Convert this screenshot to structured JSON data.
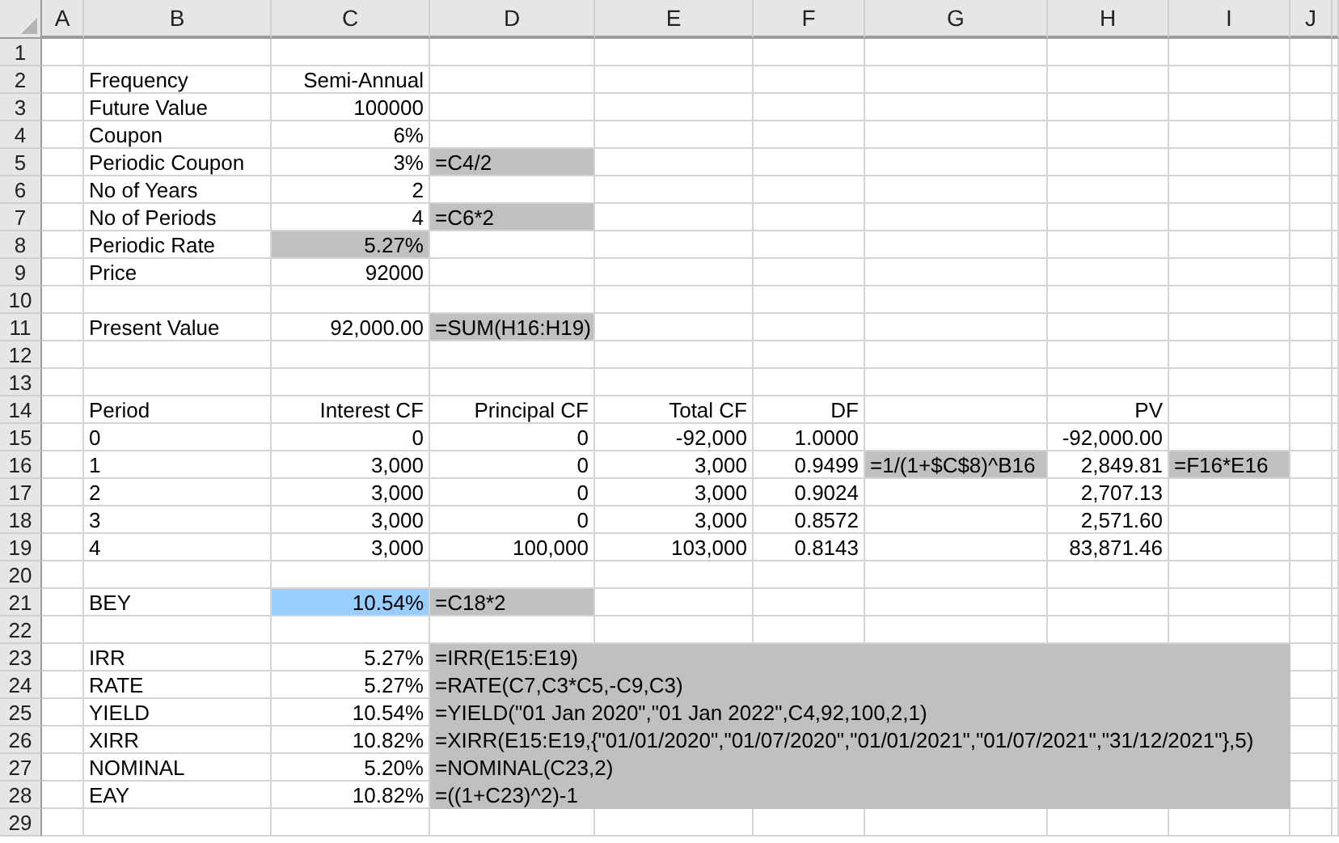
{
  "columns": [
    {
      "label": "A"
    },
    {
      "label": "B"
    },
    {
      "label": "C"
    },
    {
      "label": "D"
    },
    {
      "label": "E"
    },
    {
      "label": "F"
    },
    {
      "label": "G"
    },
    {
      "label": "H"
    },
    {
      "label": "I"
    },
    {
      "label": "J"
    }
  ],
  "rows": [
    {
      "number": "1"
    },
    {
      "number": "2",
      "cells": {
        "B": {
          "text": "Frequency",
          "kind": "label"
        },
        "C": {
          "text": "Semi-Annual",
          "kind": "value"
        }
      }
    },
    {
      "number": "3",
      "cells": {
        "B": {
          "text": "Future Value",
          "kind": "label"
        },
        "C": {
          "text": "100000",
          "kind": "value"
        }
      }
    },
    {
      "number": "4",
      "cells": {
        "B": {
          "text": "Coupon",
          "kind": "label"
        },
        "C": {
          "text": "6%",
          "kind": "value"
        }
      }
    },
    {
      "number": "5",
      "cells": {
        "B": {
          "text": "Periodic Coupon",
          "kind": "label"
        },
        "C": {
          "text": "3%",
          "kind": "value"
        },
        "D": {
          "text": "=C4/2",
          "kind": "formula",
          "color": "#c0c0c0"
        }
      }
    },
    {
      "number": "6",
      "cells": {
        "B": {
          "text": "No of Years",
          "kind": "label"
        },
        "C": {
          "text": "2",
          "kind": "value"
        }
      }
    },
    {
      "number": "7",
      "cells": {
        "B": {
          "text": "No of Periods",
          "kind": "label"
        },
        "C": {
          "text": "4",
          "kind": "value"
        },
        "D": {
          "text": "=C6*2",
          "kind": "formula",
          "color": "#c0c0c0"
        }
      }
    },
    {
      "number": "8",
      "cells": {
        "B": {
          "text": "Periodic Rate",
          "kind": "label"
        },
        "C": {
          "text": "5.27%",
          "kind": "value",
          "color": "#c0c0c0"
        }
      }
    },
    {
      "number": "9",
      "cells": {
        "B": {
          "text": "Price",
          "kind": "label"
        },
        "C": {
          "text": "92000",
          "kind": "value"
        }
      }
    },
    {
      "number": "10"
    },
    {
      "number": "11",
      "cells": {
        "B": {
          "text": "Present Value",
          "kind": "label"
        },
        "C": {
          "text": "92,000.00",
          "kind": "value"
        },
        "D": {
          "text": "=SUM(H16:H19)",
          "kind": "formula",
          "color": "#c0c0c0"
        }
      }
    },
    {
      "number": "12"
    },
    {
      "number": "13"
    },
    {
      "number": "14",
      "cells": {
        "B": {
          "text": "Period",
          "kind": "label"
        },
        "C": {
          "text": "Interest CF",
          "kind": "value"
        },
        "D": {
          "text": "Principal CF",
          "kind": "value"
        },
        "E": {
          "text": "Total CF",
          "kind": "value"
        },
        "F": {
          "text": "DF",
          "kind": "value"
        },
        "H": {
          "text": "PV",
          "kind": "value"
        }
      }
    },
    {
      "number": "15",
      "cells": {
        "B": {
          "text": "0",
          "kind": "label"
        },
        "C": {
          "text": "0",
          "kind": "value"
        },
        "D": {
          "text": "0",
          "kind": "value"
        },
        "E": {
          "text": "-92,000",
          "kind": "value"
        },
        "F": {
          "text": "1.0000",
          "kind": "value"
        },
        "H": {
          "text": "-92,000.00",
          "kind": "value"
        }
      }
    },
    {
      "number": "16",
      "cells": {
        "B": {
          "text": "1",
          "kind": "label"
        },
        "C": {
          "text": "3,000",
          "kind": "value"
        },
        "D": {
          "text": "0",
          "kind": "value"
        },
        "E": {
          "text": "3,000",
          "kind": "value"
        },
        "F": {
          "text": "0.9499",
          "kind": "value"
        },
        "G": {
          "text": "=1/(1+$C$8)^B16",
          "kind": "formula",
          "color": "#c0c0c0"
        },
        "H": {
          "text": "2,849.81",
          "kind": "value"
        },
        "I": {
          "text": "=F16*E16",
          "kind": "formula",
          "color": "#c0c0c0"
        }
      }
    },
    {
      "number": "17",
      "cells": {
        "B": {
          "text": "2",
          "kind": "label"
        },
        "C": {
          "text": "3,000",
          "kind": "value"
        },
        "D": {
          "text": "0",
          "kind": "value"
        },
        "E": {
          "text": "3,000",
          "kind": "value"
        },
        "F": {
          "text": "0.9024",
          "kind": "value"
        },
        "H": {
          "text": "2,707.13",
          "kind": "value"
        }
      }
    },
    {
      "number": "18",
      "cells": {
        "B": {
          "text": "3",
          "kind": "label"
        },
        "C": {
          "text": "3,000",
          "kind": "value"
        },
        "D": {
          "text": "0",
          "kind": "value"
        },
        "E": {
          "text": "3,000",
          "kind": "value"
        },
        "F": {
          "text": "0.8572",
          "kind": "value"
        },
        "H": {
          "text": "2,571.60",
          "kind": "value"
        }
      }
    },
    {
      "number": "19",
      "cells": {
        "B": {
          "text": "4",
          "kind": "label"
        },
        "C": {
          "text": "3,000",
          "kind": "value"
        },
        "D": {
          "text": "100,000",
          "kind": "value"
        },
        "E": {
          "text": "103,000",
          "kind": "value"
        },
        "F": {
          "text": "0.8143",
          "kind": "value"
        },
        "H": {
          "text": "83,871.46",
          "kind": "value"
        }
      }
    },
    {
      "number": "20"
    },
    {
      "number": "21",
      "cells": {
        "B": {
          "text": "BEY",
          "kind": "label"
        },
        "C": {
          "text": "10.54%",
          "kind": "value",
          "color": "#99ccff"
        },
        "D": {
          "text": "=C18*2",
          "kind": "formula",
          "color": "#c0c0c0"
        }
      }
    },
    {
      "number": "22"
    },
    {
      "number": "23",
      "cells": {
        "B": {
          "text": "IRR",
          "kind": "label"
        },
        "C": {
          "text": "5.27%",
          "kind": "value"
        },
        "D": {
          "text": "=IRR(E15:E19)",
          "kind": "formula",
          "color": "#c0c0c0",
          "merged": true
        }
      }
    },
    {
      "number": "24",
      "cells": {
        "B": {
          "text": "RATE",
          "kind": "label"
        },
        "C": {
          "text": "5.27%",
          "kind": "value"
        },
        "D": {
          "text": "=RATE(C7,C3*C5,-C9,C3)",
          "kind": "formula",
          "color": "#c0c0c0",
          "merged": true
        }
      }
    },
    {
      "number": "25",
      "cells": {
        "B": {
          "text": "YIELD",
          "kind": "label"
        },
        "C": {
          "text": "10.54%",
          "kind": "value"
        },
        "D": {
          "text": "=YIELD(\"01 Jan 2020\",\"01 Jan 2022\",C4,92,100,2,1)",
          "kind": "formula",
          "color": "#c0c0c0",
          "merged": true
        }
      }
    },
    {
      "number": "26",
      "cells": {
        "B": {
          "text": "XIRR",
          "kind": "label"
        },
        "C": {
          "text": "10.82%",
          "kind": "value"
        },
        "D": {
          "text": "=XIRR(E15:E19,{\"01/01/2020\",\"01/07/2020\",\"01/01/2021\",\"01/07/2021\",\"31/12/2021\"},5)",
          "kind": "formula",
          "color": "#c0c0c0",
          "merged": true
        }
      }
    },
    {
      "number": "27",
      "cells": {
        "B": {
          "text": "NOMINAL",
          "kind": "label"
        },
        "C": {
          "text": "5.20%",
          "kind": "value"
        },
        "D": {
          "text": "=NOMINAL(C23,2)",
          "kind": "formula",
          "color": "#c0c0c0",
          "merged": true
        }
      }
    },
    {
      "number": "28",
      "cells": {
        "B": {
          "text": "EAY",
          "kind": "label"
        },
        "C": {
          "text": "10.82%",
          "kind": "value"
        },
        "D": {
          "text": "=((1+C23)^2)-1",
          "kind": "formula",
          "color": "#c0c0c0",
          "merged": true
        }
      }
    },
    {
      "number": "29"
    }
  ]
}
